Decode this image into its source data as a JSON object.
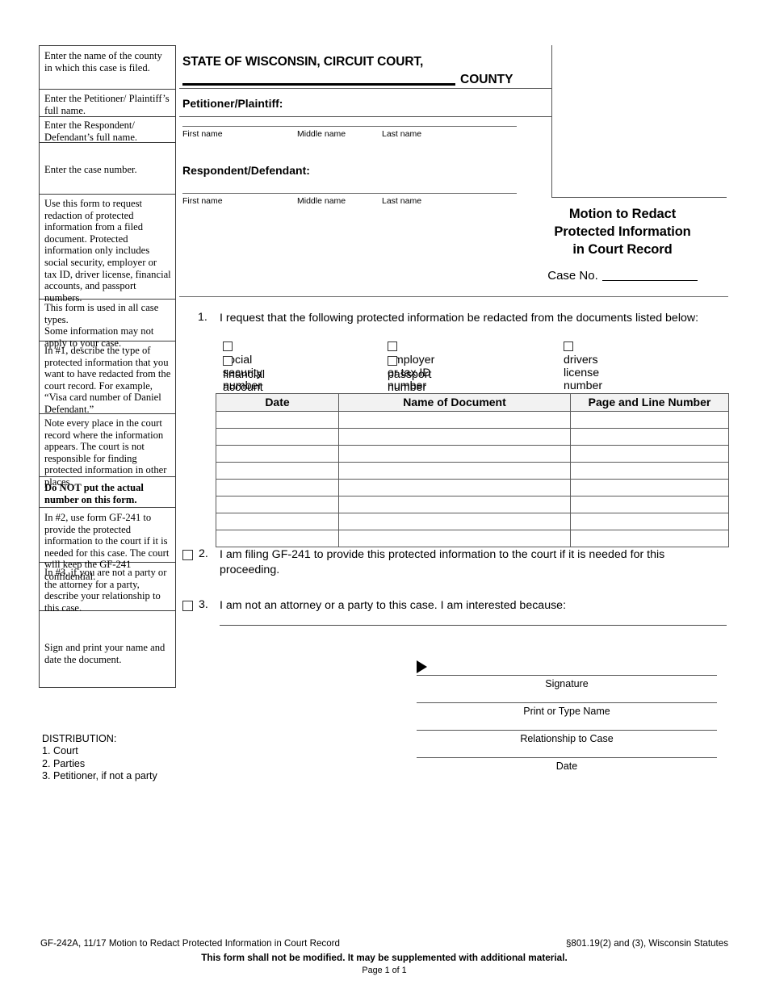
{
  "document": {
    "form_id": "GF-242A",
    "title_lines": [
      "Motion to Redact",
      "Protected Information",
      "in Court Record"
    ],
    "case_no_label": "Case No."
  },
  "caption": {
    "court_title": "STATE OF WISCONSIN, CIRCUIT COURT,",
    "county_word": "COUNTY",
    "petitioner_label": "Petitioner/Plaintiff",
    "petitioner_colon": ":",
    "respondent_label": "Respondent/Defendant",
    "respondent_colon": ":",
    "name_hints": {
      "first": "First name",
      "middle": "Middle name",
      "last": "Last name"
    }
  },
  "sidebar": {
    "items": [
      {
        "id": "county-instruction",
        "text": "Enter the name of the county in which this case is filed.",
        "bold": false
      },
      {
        "id": "petitioner-instruction",
        "text": "Enter the Petitioner/ Plaintiff’s full name.",
        "bold": false
      },
      {
        "id": "respondent-instruction",
        "text": "Enter the Respondent/ Defendant’s full name.",
        "bold": false
      },
      {
        "id": "case-number-instruction",
        "text": "Enter the case number.",
        "bold": false
      },
      {
        "id": "purpose-instruction",
        "text": "Use this form to request redaction of protected information from a filed document. Protected information only includes social security, employer or tax ID, driver license, financial accounts, and passport numbers.",
        "bold": false
      },
      {
        "id": "case-types-instruction",
        "text": "This form is used in all case types.",
        "text2": "Some information may not apply to your case.",
        "bold": false
      },
      {
        "id": "item1-instruction",
        "text": "In #1, describe the type of protected information that you want to have redacted from the court record. For example, “Visa card number of Daniel Defendant.”",
        "bold": false
      },
      {
        "id": "note-every-place-instruction",
        "text": "Note every place in the court record where the information appears. The court is not responsible for finding protected information in other places.",
        "bold": false
      },
      {
        "id": "do-not-put-number-warning",
        "text": "Do NOT put the actual number on this form.",
        "bold": true
      },
      {
        "id": "item2-instruction",
        "text": "In #2, use form GF-241 to provide the protected information to the court if it is needed for this case. The court will keep the GF-241 confidential.",
        "bold": false
      },
      {
        "id": "item3-instruction",
        "text": "In #3, if you are not a party or the attorney for a party, describe your relationship to this case.",
        "bold": false
      },
      {
        "id": "sign-instruction",
        "text": "Sign and print your name and date the document.",
        "bold": false
      }
    ]
  },
  "item1": {
    "number": "1.",
    "text": "I request that the following protected information be redacted from the documents listed below:",
    "checkboxes": [
      {
        "id": "social-security-number",
        "label": "social security number",
        "checked": false
      },
      {
        "id": "employer-or-tax-id-number",
        "label": "employer or tax ID number",
        "checked": false
      },
      {
        "id": "drivers-license-number",
        "label": "drivers license number",
        "checked": false
      },
      {
        "id": "financial-account-numbers",
        "label": "financial account numbers",
        "checked": false
      },
      {
        "id": "passport-number",
        "label": "passport number",
        "checked": false
      }
    ]
  },
  "table": {
    "headers": [
      "Date",
      "Name of Document",
      "Page and Line Number"
    ],
    "rows": [
      [
        "",
        "",
        ""
      ],
      [
        "",
        "",
        ""
      ],
      [
        "",
        "",
        ""
      ],
      [
        "",
        "",
        ""
      ],
      [
        "",
        "",
        ""
      ],
      [
        "",
        "",
        ""
      ],
      [
        "",
        "",
        ""
      ],
      [
        "",
        "",
        ""
      ]
    ]
  },
  "item2": {
    "number": "2.",
    "checked": false,
    "text": "I am filing GF-241 to provide this protected information to the court if it is needed for this proceeding."
  },
  "item3": {
    "number": "3.",
    "checked": false,
    "text": "I am not an attorney or a party to this case. I am interested because:",
    "answer": ""
  },
  "signature_block": {
    "lines": [
      {
        "id": "signature",
        "caption": "Signature",
        "value": ""
      },
      {
        "id": "print-or-type-name",
        "caption": "Print or Type Name",
        "value": ""
      },
      {
        "id": "relationship-to-case",
        "caption": "Relationship to Case",
        "value": ""
      },
      {
        "id": "date",
        "caption": "Date",
        "value": ""
      }
    ]
  },
  "distribution": {
    "heading": "DISTRIBUTION:",
    "items": [
      "1. Court",
      "2. Parties",
      "3. Petitioner, if not a party"
    ]
  },
  "footer": {
    "left": "GF-242A, 11/17 Motion to Redact Protected Information in Court Record",
    "right": "§801.19(2) and (3), Wisconsin Statutes",
    "center": "This form shall not be modified.  It may be supplemented with additional material.",
    "page": "Page 1 of 1"
  }
}
